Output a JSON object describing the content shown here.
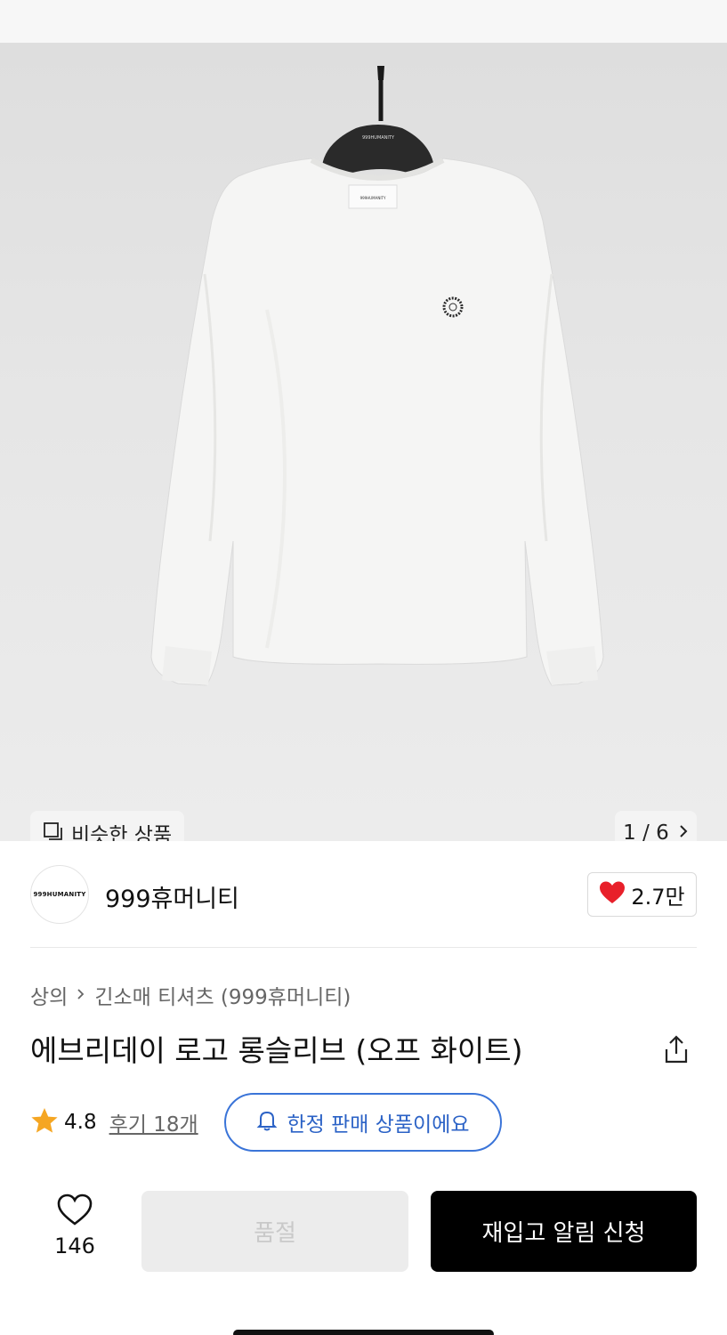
{
  "gallery": {
    "similar_label": "비슷한 상품",
    "counter": "1 / 6",
    "hanger_tag_text": "999HUMANITY",
    "shirt_tag_text": "999HUMANITY"
  },
  "brand": {
    "logo_text": "999HUMANITY",
    "name": "999휴머니티",
    "like_count": "2.7만"
  },
  "breadcrumb": {
    "category": "상의",
    "subcategory": "긴소매 티셔츠 (999휴머니티)"
  },
  "product": {
    "title": "에브리데이 로고 롱슬리브 (오프 화이트)"
  },
  "rating": {
    "score": "4.8",
    "reviews": "후기 18개",
    "limited_label": "한정 판매 상품이에요"
  },
  "actions": {
    "wish_count": "146",
    "soldout_label": "품절",
    "restock_label": "재입고 알림 신청"
  },
  "colors": {
    "accent_blue": "#3a74d8",
    "heart_red": "#e8202a",
    "star": "#f5a623"
  }
}
